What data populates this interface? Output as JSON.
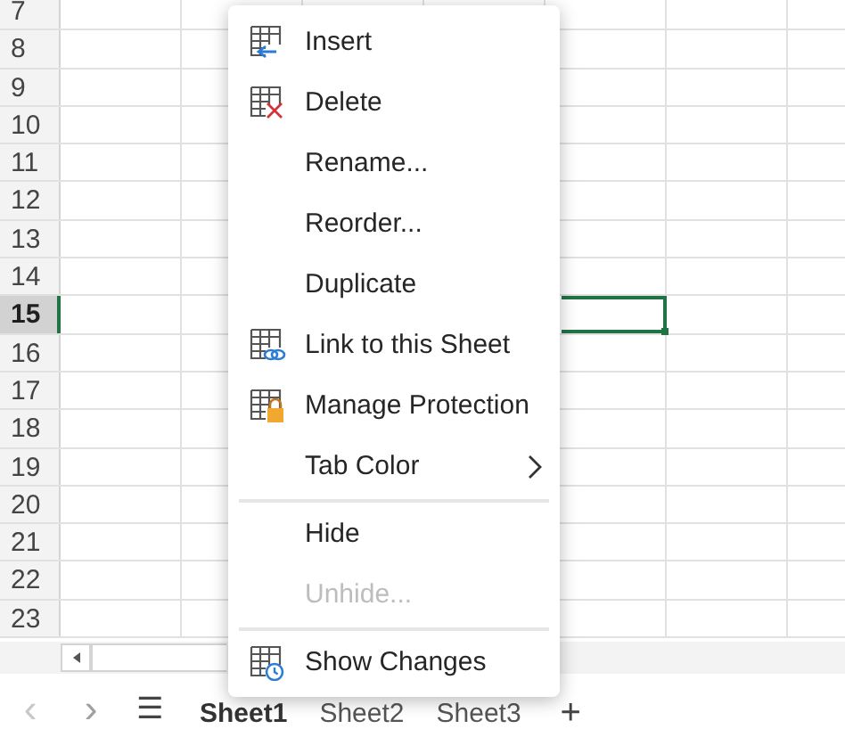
{
  "rows": [
    {
      "label": "7",
      "selected": false
    },
    {
      "label": "8",
      "selected": false
    },
    {
      "label": "9",
      "selected": false
    },
    {
      "label": "10",
      "selected": false
    },
    {
      "label": "11",
      "selected": false
    },
    {
      "label": "12",
      "selected": false
    },
    {
      "label": "13",
      "selected": false
    },
    {
      "label": "14",
      "selected": false
    },
    {
      "label": "15",
      "selected": true
    },
    {
      "label": "16",
      "selected": false
    },
    {
      "label": "17",
      "selected": false
    },
    {
      "label": "18",
      "selected": false
    },
    {
      "label": "19",
      "selected": false
    },
    {
      "label": "20",
      "selected": false
    },
    {
      "label": "21",
      "selected": false
    },
    {
      "label": "22",
      "selected": false
    },
    {
      "label": "23",
      "selected": false
    }
  ],
  "sheet_tabs": [
    {
      "label": "Sheet1",
      "selected": true
    },
    {
      "label": "Sheet2",
      "selected": false
    },
    {
      "label": "Sheet3",
      "selected": false
    }
  ],
  "tab_nav": {
    "prev": "‹",
    "next": "›",
    "menu": "☰",
    "add": "+"
  },
  "context_menu": [
    {
      "kind": "insert",
      "label": "Insert",
      "disabled": false
    },
    {
      "kind": "delete",
      "label": "Delete",
      "disabled": false
    },
    {
      "kind": "plain",
      "label": "Rename...",
      "disabled": false
    },
    {
      "kind": "plain",
      "label": "Reorder...",
      "disabled": false
    },
    {
      "kind": "plain",
      "label": "Duplicate",
      "disabled": false
    },
    {
      "kind": "link",
      "label": "Link to this Sheet",
      "disabled": false
    },
    {
      "kind": "protect",
      "label": "Manage Protection",
      "disabled": false
    },
    {
      "kind": "submenu",
      "label": "Tab Color",
      "disabled": false
    },
    {
      "kind": "separator"
    },
    {
      "kind": "plain",
      "label": "Hide",
      "disabled": false
    },
    {
      "kind": "plain",
      "label": "Unhide...",
      "disabled": true
    },
    {
      "kind": "separator"
    },
    {
      "kind": "changes",
      "label": "Show Changes",
      "disabled": false
    }
  ]
}
